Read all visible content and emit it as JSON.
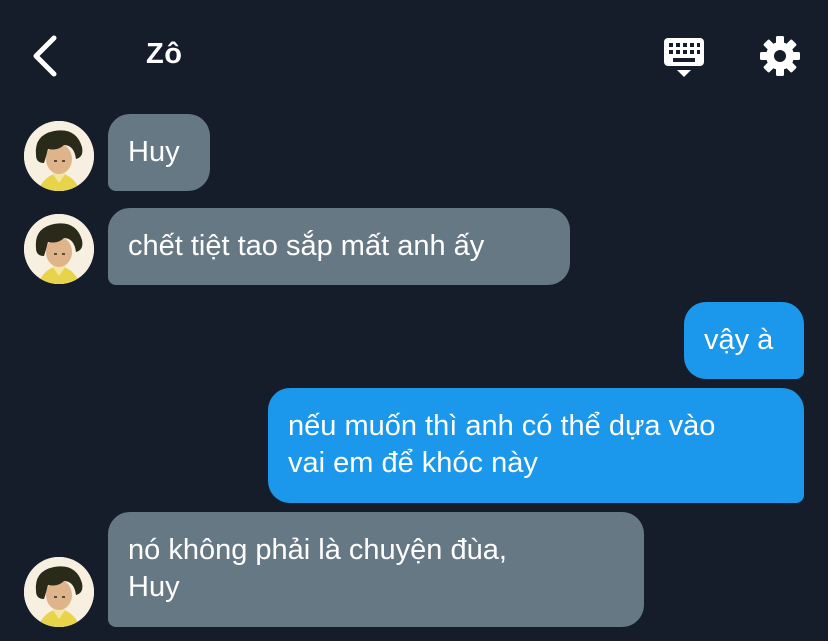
{
  "header": {
    "title": "Zô",
    "back_icon": "chevron-left-icon",
    "keyboard_icon": "keyboard-icon",
    "settings_icon": "gear-icon"
  },
  "colors": {
    "background": "#151d2a",
    "incoming_bubble": "#677885",
    "outgoing_bubble": "#1b97eb",
    "text": "#ffffff"
  },
  "messages": [
    {
      "side": "incoming",
      "text": "Huy"
    },
    {
      "side": "incoming",
      "text": "chết tiệt tao sắp mất anh ấy"
    },
    {
      "side": "outgoing",
      "text": "vậy à"
    },
    {
      "side": "outgoing",
      "text": "nếu muốn thì anh có thể dựa vào\nvai em để khóc này"
    },
    {
      "side": "incoming",
      "text": "nó không phải là chuyện đùa,\nHuy"
    }
  ]
}
